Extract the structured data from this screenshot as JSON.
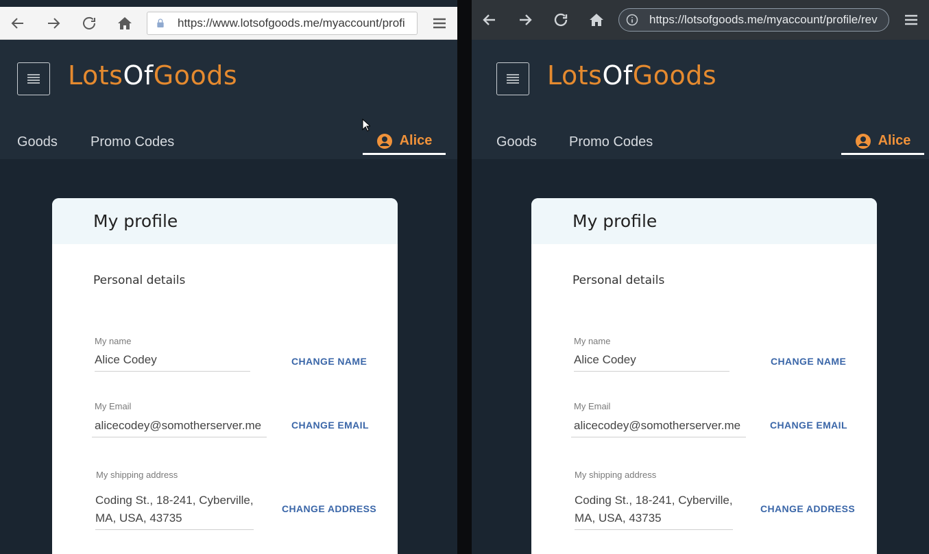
{
  "panes": [
    {
      "id": "left",
      "browser_theme": "light",
      "url_lead_icon": "lock-icon",
      "url": "https://www.lotsofgoods.me/myaccount/profi"
    },
    {
      "id": "right",
      "browser_theme": "dark",
      "url_lead_icon": "info-icon",
      "url": "https://lotsofgoods.me/myaccount/profile/rev"
    }
  ],
  "site": {
    "logo_part1": "Lots",
    "logo_part2": "Of",
    "logo_part3": "Goods",
    "nav": {
      "goods": "Goods",
      "promo": "Promo Codes",
      "user": "Alice"
    }
  },
  "profile": {
    "title": "My profile",
    "section": "Personal details",
    "name_label": "My name",
    "name_value": "Alice Codey",
    "name_button": "CHANGE NAME",
    "email_label": "My Email",
    "email_value": "alicecodey@somotherserver.me",
    "email_button": "CHANGE EMAIL",
    "address_label": "My shipping address",
    "address_line1": "Coding St., 18-241, Cyberville,",
    "address_line2": "MA, USA, 43735",
    "address_button": "CHANGE ADDRESS"
  },
  "colors": {
    "brand_orange": "#e58a2f",
    "header_bg": "#212d39",
    "page_bg": "#1a2530",
    "link_blue": "#3a66a8"
  }
}
